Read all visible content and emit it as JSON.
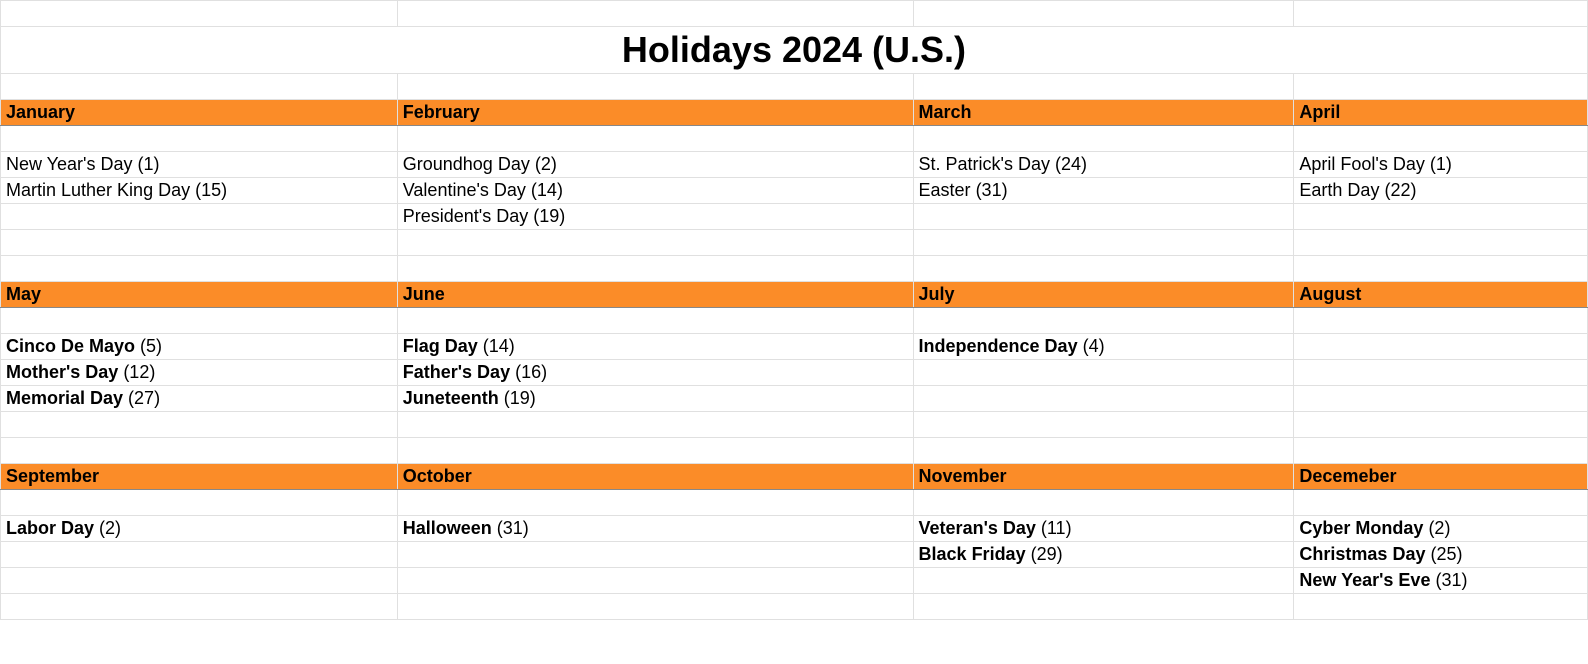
{
  "title": "Holidays 2024 (U.S.)",
  "columns": [
    {
      "month": "January",
      "holidays": [
        {
          "name": "New Year's Day",
          "day": 1,
          "bold": false
        },
        {
          "name": "Martin Luther King Day",
          "day": 15,
          "bold": false
        }
      ]
    },
    {
      "month": "February",
      "holidays": [
        {
          "name": "Groundhog Day",
          "day": 2,
          "bold": false
        },
        {
          "name": "Valentine's Day",
          "day": 14,
          "bold": false
        },
        {
          "name": "President's Day",
          "day": 19,
          "bold": false
        }
      ]
    },
    {
      "month": "March",
      "holidays": [
        {
          "name": "St. Patrick's Day",
          "day": 24,
          "bold": false
        },
        {
          "name": "Easter",
          "day": 31,
          "bold": false
        }
      ]
    },
    {
      "month": "April",
      "holidays": [
        {
          "name": "April Fool's Day",
          "day": 1,
          "bold": false
        },
        {
          "name": "Earth Day",
          "day": 22,
          "bold": false
        }
      ]
    },
    {
      "month": "May",
      "holidays": [
        {
          "name": "Cinco De Mayo",
          "day": 5,
          "bold": true
        },
        {
          "name": "Mother's Day",
          "day": 12,
          "bold": true
        },
        {
          "name": "Memorial Day",
          "day": 27,
          "bold": true
        }
      ]
    },
    {
      "month": "June",
      "holidays": [
        {
          "name": "Flag Day",
          "day": 14,
          "bold": true
        },
        {
          "name": "Father's Day",
          "day": 16,
          "bold": true
        },
        {
          "name": "Juneteenth",
          "day": 19,
          "bold": true
        }
      ]
    },
    {
      "month": "July",
      "holidays": [
        {
          "name": "Independence Day",
          "day": 4,
          "bold": true
        }
      ]
    },
    {
      "month": "August",
      "holidays": []
    },
    {
      "month": "September",
      "holidays": [
        {
          "name": "Labor Day",
          "day": 2,
          "bold": true
        }
      ]
    },
    {
      "month": "October",
      "holidays": [
        {
          "name": "Halloween",
          "day": 31,
          "bold": true
        }
      ]
    },
    {
      "month": "November",
      "holidays": [
        {
          "name": "Veteran's Day",
          "day": 11,
          "bold": true
        },
        {
          "name": "Black Friday",
          "day": 29,
          "bold": true
        }
      ]
    },
    {
      "month": "Decemeber",
      "holidays": [
        {
          "name": "Cyber Monday",
          "day": 2,
          "bold": true
        },
        {
          "name": "Christmas Day",
          "day": 25,
          "bold": true
        },
        {
          "name": "New Year's Eve",
          "day": 31,
          "bold": true
        }
      ]
    }
  ],
  "layout": {
    "groupsPerRow": 4,
    "holidayRowsPerGroup": 3,
    "trailingBlankRows": [
      2,
      2,
      1
    ]
  }
}
